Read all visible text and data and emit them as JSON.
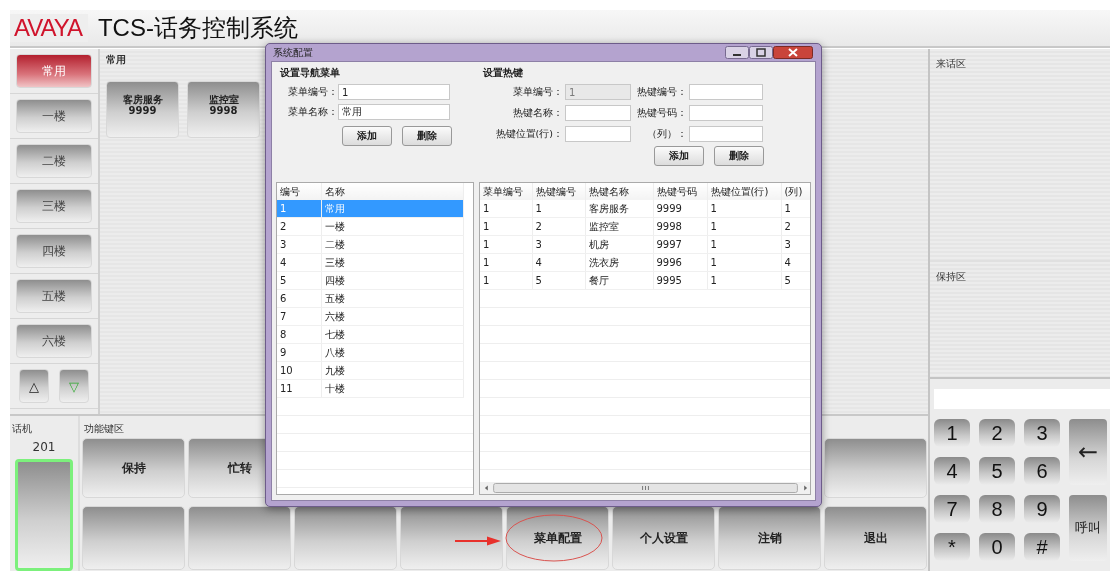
{
  "header": {
    "logo": "AVAYA",
    "title": "TCS-话务控制系统"
  },
  "nav": {
    "items": [
      {
        "label": "常用",
        "selected": true
      },
      {
        "label": "一楼",
        "selected": false
      },
      {
        "label": "二楼",
        "selected": false
      },
      {
        "label": "三楼",
        "selected": false
      },
      {
        "label": "四楼",
        "selected": false
      },
      {
        "label": "五楼",
        "selected": false
      },
      {
        "label": "六楼",
        "selected": false
      }
    ],
    "up_button": "△",
    "down_button": "▽"
  },
  "hotkey_area": {
    "title": "常用",
    "keys": [
      {
        "name": "客房服务",
        "number": "9999"
      },
      {
        "name": "监控室",
        "number": "9998"
      }
    ]
  },
  "phone": {
    "label": "话机",
    "extension": "201",
    "active": true
  },
  "function_keys": {
    "label": "功能键区",
    "rows": [
      [
        {
          "kind": "labeled",
          "label": "保持"
        },
        {
          "kind": "labeled",
          "label": "忙转"
        },
        {
          "kind": "blank"
        }
      ],
      [
        {
          "kind": "blank"
        },
        {
          "kind": "blank"
        },
        {
          "kind": "blank"
        },
        {
          "kind": "blank"
        },
        {
          "kind": "labeled",
          "label": "菜单配置"
        },
        {
          "kind": "labeled",
          "label": "个人设置"
        },
        {
          "kind": "labeled",
          "label": "注销"
        },
        {
          "kind": "labeled",
          "label": "退出"
        }
      ]
    ]
  },
  "right_panel": {
    "incoming_label": "来话区",
    "hold_label": "保持区",
    "keypad": {
      "keys": [
        "1",
        "2",
        "3",
        "4",
        "5",
        "6",
        "7",
        "8",
        "9",
        "*",
        "0",
        "#"
      ],
      "backspace": "←",
      "call": "呼叫"
    }
  },
  "dialog": {
    "title": "系统配置",
    "nav_menu": {
      "title": "设置导航菜单",
      "fields": [
        {
          "label": "菜单编号：",
          "value": "1"
        },
        {
          "label": "菜单名称：",
          "value": "常用"
        }
      ],
      "buttons": [
        "添加",
        "删除"
      ],
      "table": {
        "columns": [
          "编号",
          "名称"
        ],
        "rows": [
          {
            "cells": [
              "1",
              "常用"
            ],
            "selected": true
          },
          {
            "cells": [
              "2",
              "一楼"
            ],
            "selected": false
          },
          {
            "cells": [
              "3",
              "二楼"
            ],
            "selected": false
          },
          {
            "cells": [
              "4",
              "三楼"
            ],
            "selected": false
          },
          {
            "cells": [
              "5",
              "四楼"
            ],
            "selected": false
          },
          {
            "cells": [
              "6",
              "五楼"
            ],
            "selected": false
          },
          {
            "cells": [
              "7",
              "六楼"
            ],
            "selected": false
          },
          {
            "cells": [
              "8",
              "七楼"
            ],
            "selected": false
          },
          {
            "cells": [
              "9",
              "八楼"
            ],
            "selected": false
          },
          {
            "cells": [
              "10",
              "九楼"
            ],
            "selected": false
          },
          {
            "cells": [
              "11",
              "十楼"
            ],
            "selected": false
          }
        ]
      }
    },
    "hotkeys": {
      "title": "设置热键",
      "fields": [
        {
          "label": "菜单编号：",
          "value": "1",
          "disabled": true
        },
        {
          "label": "热键编号：",
          "disabled": false
        },
        {
          "label": "热键名称：",
          "disabled": false
        },
        {
          "label": "热键号码：",
          "disabled": false
        },
        {
          "label": "热键位置(行)：",
          "disabled": false
        },
        {
          "label": "（列）：",
          "disabled": false
        }
      ],
      "buttons": [
        "添加",
        "删除"
      ],
      "table": {
        "columns": [
          "菜单编号",
          "热键编号",
          "热键名称",
          "热键号码",
          "热键位置(行)",
          "(列)"
        ],
        "rows": [
          {
            "cells": [
              "1",
              "1",
              "客房服务",
              "9999",
              "1",
              "1"
            ],
            "selected": false
          },
          {
            "cells": [
              "1",
              "2",
              "监控室",
              "9998",
              "1",
              "2"
            ],
            "selected": false
          },
          {
            "cells": [
              "1",
              "3",
              "机房",
              "9997",
              "1",
              "3"
            ],
            "selected": false
          },
          {
            "cells": [
              "1",
              "4",
              "洗衣房",
              "9996",
              "1",
              "4"
            ],
            "selected": false
          },
          {
            "cells": [
              "1",
              "5",
              "餐厅",
              "9995",
              "1",
              "5"
            ],
            "selected": false
          }
        ]
      }
    }
  }
}
